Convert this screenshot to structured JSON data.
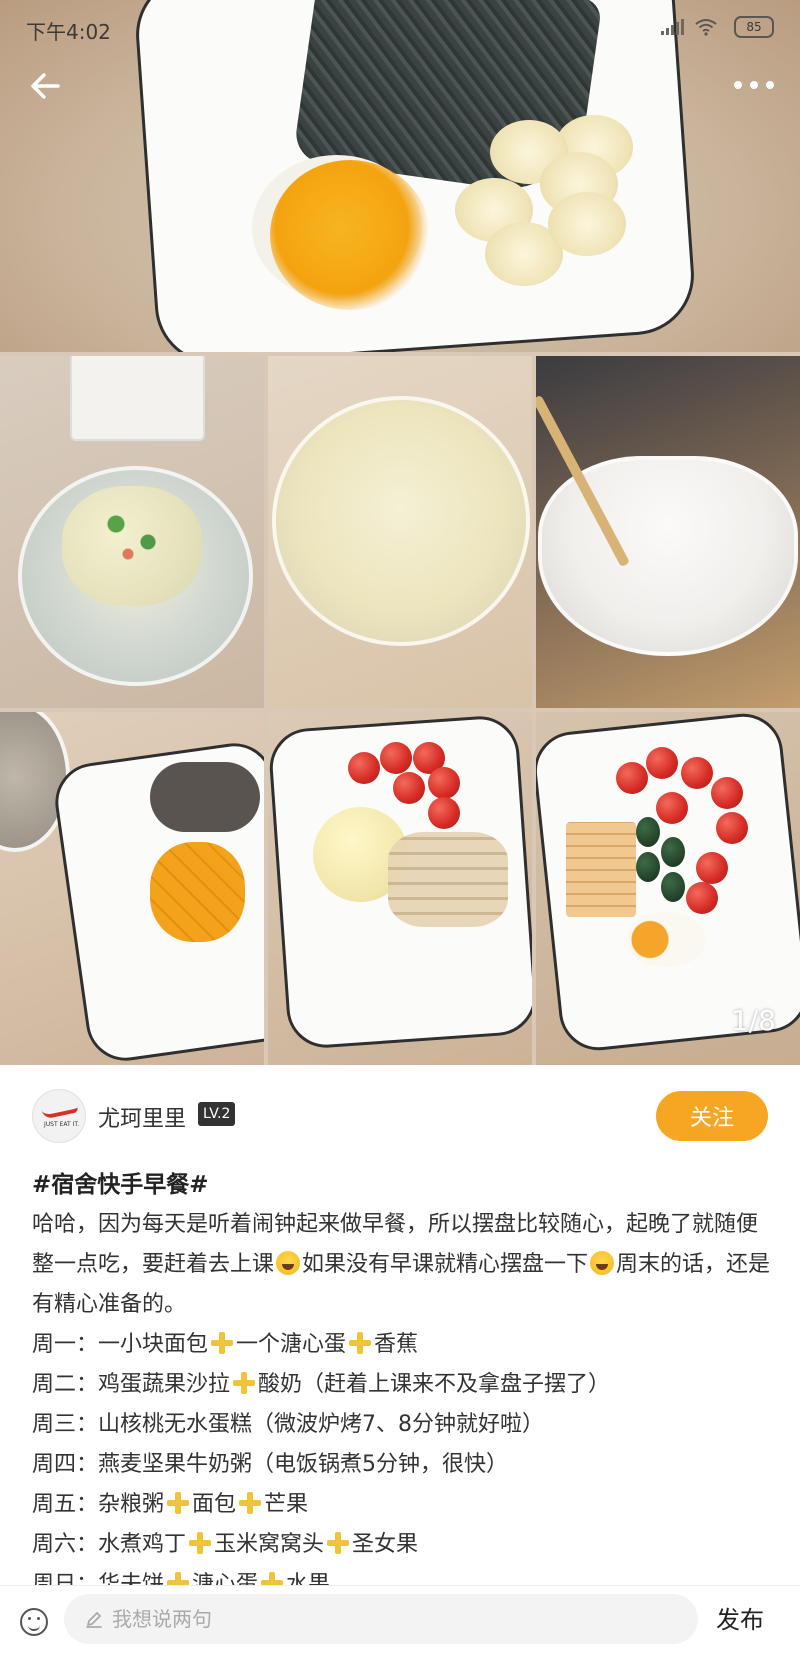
{
  "status_bar": {
    "time": "下午4:02",
    "battery": "85"
  },
  "gallery": {
    "page_indicator": "1/8"
  },
  "author": {
    "name": "尤珂里里",
    "level": "LV.2",
    "follow_label": "关注",
    "avatar_text": "JUST EAT IT."
  },
  "post": {
    "title": "#宿舍快手早餐#",
    "intro_1": "哈哈，因为每天是听着闹钟起来做早餐，所以摆盘比较随心，起晚了就随便整一点吃，要赶着去上课",
    "intro_2": "如果没有早课就精心摆盘一下",
    "intro_3": "周末的话，还是有精心准备的。",
    "days": [
      {
        "day": "周一：",
        "items": [
          "一小块面包",
          "一个溏心蛋",
          "香蕉"
        ]
      },
      {
        "day": "周二：",
        "items": [
          "鸡蛋蔬果沙拉",
          "酸奶（赶着上课来不及拿盘子摆了）"
        ]
      },
      {
        "day": "周三：",
        "items": [
          "山核桃无水蛋糕（微波炉烤7、8分钟就好啦）"
        ]
      },
      {
        "day": "周四：",
        "items": [
          "燕麦坚果牛奶粥（电饭锅煮5分钟，很快）"
        ]
      },
      {
        "day": "周五：",
        "items": [
          "杂粮粥",
          "面包",
          "芒果"
        ]
      },
      {
        "day": "周六：",
        "items": [
          "水煮鸡丁",
          "玉米窝窝头",
          "圣女果"
        ]
      },
      {
        "day": "周日：",
        "items": [
          "华夫饼",
          "溏心蛋",
          "水果"
        ]
      }
    ]
  },
  "bottom_bar": {
    "comment_placeholder": "我想说两句",
    "publish_label": "发布"
  }
}
